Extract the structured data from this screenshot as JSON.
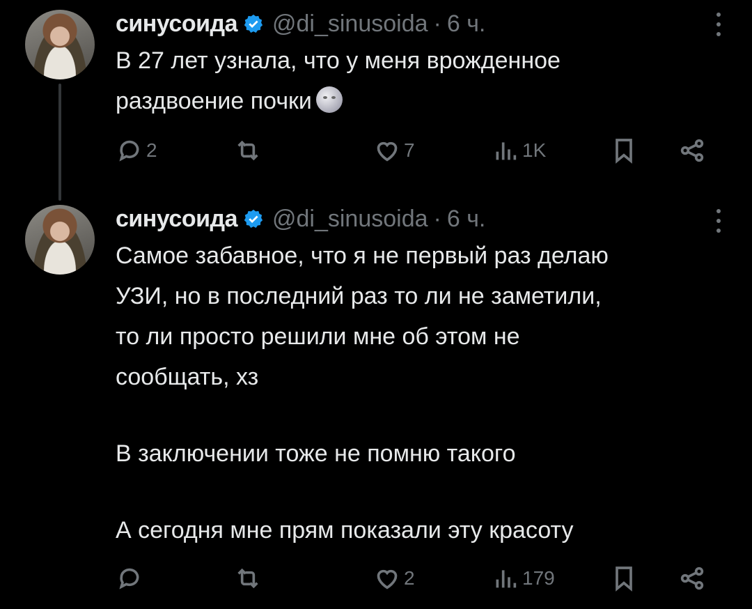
{
  "tweets": [
    {
      "name": "синусоида",
      "handle": "@di_sinusoida",
      "separator": "·",
      "time": "6 ч.",
      "text_lines": [
        "В 27 лет узнала, что у меня врожденное",
        "раздвоение почки"
      ],
      "emoji": "new-moon-face",
      "replies": "2",
      "retweets": "",
      "likes": "7",
      "views": "1K"
    },
    {
      "name": "синусоида",
      "handle": "@di_sinusoida",
      "separator": "·",
      "time": "6 ч.",
      "text_lines": [
        "Самое забавное, что я не первый раз делаю",
        "УЗИ, но в последний раз то ли не заметили,",
        "то ли просто решили мне об этом не",
        "сообщать, хз",
        "",
        "В заключении тоже не помню такого",
        "",
        "А сегодня мне прям показали эту красоту"
      ],
      "replies": "",
      "retweets": "",
      "likes": "2",
      "views": "179"
    }
  ],
  "colors": {
    "background": "#000000",
    "text": "#e7e9ea",
    "muted": "#71767b",
    "verified": "#1d9bf0",
    "thread_line": "#333639"
  },
  "icons": [
    "reply-icon",
    "retweet-icon",
    "like-icon",
    "views-icon",
    "bookmark-icon",
    "share-icon",
    "more-icon",
    "verified-badge-icon"
  ]
}
